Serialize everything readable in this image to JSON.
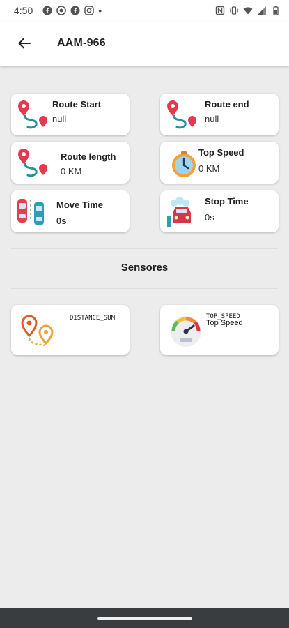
{
  "status_bar": {
    "time": "4:50",
    "dot": "•"
  },
  "app_bar": {
    "title": "AAM-966"
  },
  "stats": {
    "route_start": {
      "label": "Route Start",
      "value": "null"
    },
    "route_end": {
      "label": "Route end",
      "value": "null"
    },
    "route_length": {
      "label": "Route length",
      "value": "0 KM"
    },
    "top_speed": {
      "label": "Top Speed",
      "value": "0 KM"
    },
    "move_time": {
      "label": "Move Time",
      "value": "0s"
    },
    "stop_time": {
      "label": "Stop Time",
      "value": "0s"
    }
  },
  "sensors": {
    "title": "Sensores",
    "items": [
      {
        "code": "DISTANCE_SUM",
        "subtitle": ""
      },
      {
        "code": "TOP_SPEED",
        "subtitle": "Top Speed"
      }
    ]
  },
  "colors": {
    "pin_red": "#e53950",
    "route_teal": "#2a8f9c",
    "clock_orange": "#f0a23a",
    "car_red": "#d8354a"
  }
}
